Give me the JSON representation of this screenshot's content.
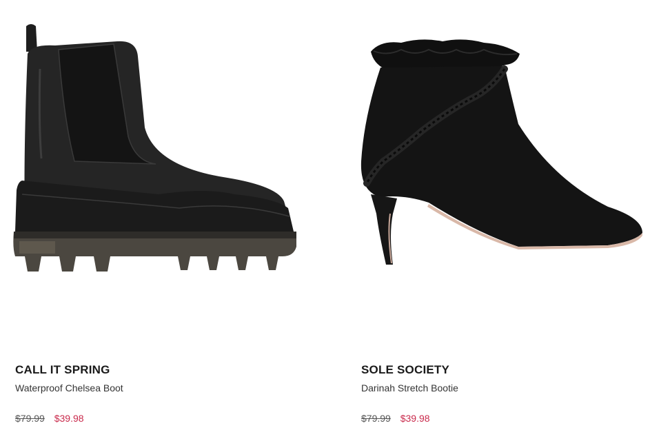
{
  "products": [
    {
      "brand": "CALL IT SPRING",
      "name": "Waterproof Chelsea Boot",
      "original_price": "$79.99",
      "sale_price": "$39.98",
      "image_icon": "chelsea-boot-icon"
    },
    {
      "brand": "SOLE SOCIETY",
      "name": "Darinah Stretch Bootie",
      "original_price": "$79.99",
      "sale_price": "$39.98",
      "image_icon": "stiletto-bootie-icon"
    }
  ],
  "colors": {
    "sale_price": "#c9294b",
    "text_primary": "#1a1a1a",
    "text_secondary": "#333333",
    "strikethrough": "#555555"
  }
}
